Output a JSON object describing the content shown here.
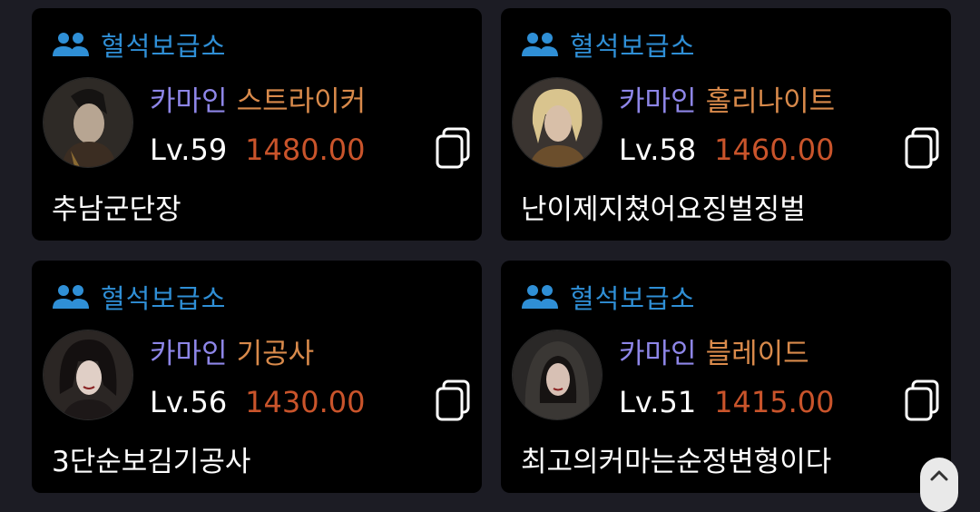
{
  "characters": [
    {
      "guild": "혈석보급소",
      "server": "카마인",
      "job": "스트라이커",
      "level": "Lv.59",
      "item_level": "1480.00",
      "nickname": "추남군단장"
    },
    {
      "guild": "혈석보급소",
      "server": "카마인",
      "job": "홀리나이트",
      "level": "Lv.58",
      "item_level": "1460.00",
      "nickname": "난이제지쳤어요징벌징벌"
    },
    {
      "guild": "혈석보급소",
      "server": "카마인",
      "job": "기공사",
      "level": "Lv.56",
      "item_level": "1430.00",
      "nickname": "3단순보김기공사"
    },
    {
      "guild": "혈석보급소",
      "server": "카마인",
      "job": "블레이드",
      "level": "Lv.51",
      "item_level": "1415.00",
      "nickname": "최고의커마는순정변형이다"
    }
  ],
  "icons": {
    "guild": "users-icon",
    "copy": "copy-icon",
    "scroll": "chevron-up-icon"
  },
  "colors": {
    "guild": "#2f8fd6",
    "server": "#8e86e8",
    "job": "#d98a4b",
    "item_level": "#c9542b",
    "card_bg": "#000000",
    "page_bg": "#1c1c24"
  }
}
